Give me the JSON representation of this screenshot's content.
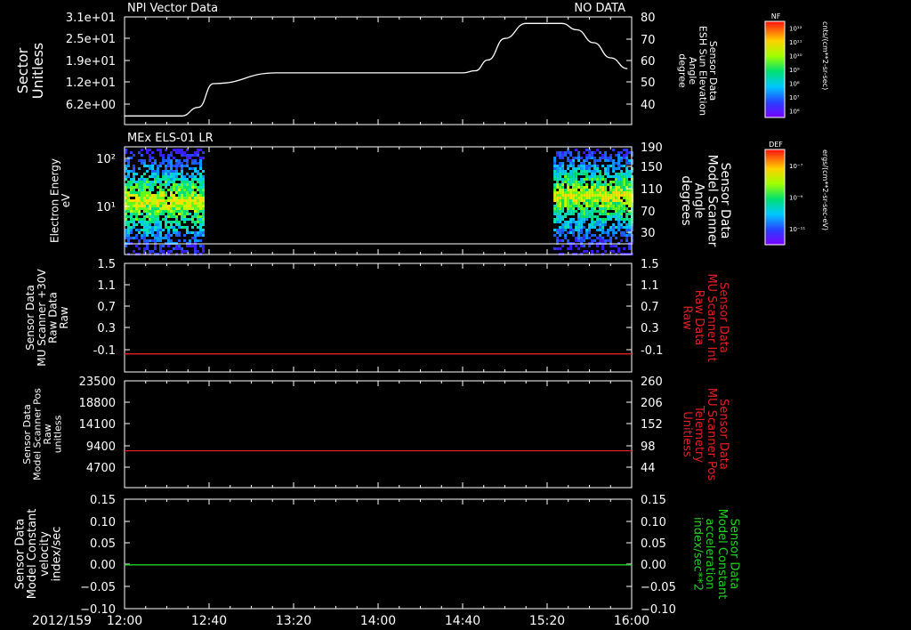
{
  "colors": {
    "background": "#000000",
    "axis": "#ffffff",
    "red_series": "#e02020",
    "green_series": "#20d020",
    "white_series": "#ffffff"
  },
  "time_axis": {
    "date_label": "2012/159",
    "ticks": [
      "12:00",
      "12:40",
      "13:20",
      "14:00",
      "14:40",
      "15:20",
      "16:00"
    ],
    "range_minutes": [
      0,
      240
    ]
  },
  "colorbars": [
    {
      "tag": "NF",
      "unit": "cnts/(cm**2-sr-sec)",
      "ticks": [
        "10¹²",
        "10¹¹",
        "10¹⁰",
        "10⁹",
        "10⁸",
        "10⁷",
        "10⁶"
      ]
    },
    {
      "tag": "DEF",
      "unit": "ergs/(cm**2-sr-sec-eV)",
      "ticks": [
        "10⁻⁷",
        "10⁻⁹",
        "10⁻¹¹"
      ]
    }
  ],
  "chart_data": [
    {
      "type": "line",
      "title": "NPI Vector Data",
      "status": "NO DATA",
      "left_axis": {
        "label_lines": [
          "Sector",
          "Unitless"
        ],
        "ticks": [
          "3.1e+01",
          "2.5e+01",
          "1.9e+01",
          "1.2e+01",
          "6.2e+00"
        ]
      },
      "right_axis": {
        "label_lines": [
          "Sensor Data",
          "ESH Sun Elevation",
          "Angle",
          "degree"
        ],
        "ticks": [
          "80",
          "70",
          "60",
          "50",
          "40"
        ],
        "ylim": [
          30,
          80
        ]
      },
      "series": [
        {
          "color": "white",
          "axis": "right",
          "x_minutes": [
            0,
            27,
            35,
            42,
            72,
            120,
            160,
            166,
            172,
            180,
            190,
            207,
            214,
            222,
            230,
            238
          ],
          "y": [
            34,
            34,
            38,
            49,
            54,
            54,
            54,
            55,
            60,
            70,
            77,
            77,
            74,
            68,
            61,
            56
          ]
        }
      ]
    },
    {
      "type": "heatmap",
      "title": "MEx ELS-01 LR",
      "left_axis": {
        "label_lines": [
          "Electron Energy",
          "eV"
        ],
        "ticks": [
          "10²",
          "10¹"
        ],
        "scale": "log"
      },
      "right_axis": {
        "label_lines": [
          "Sensor Data",
          "Model Scanner",
          "Angle",
          "degrees"
        ],
        "ticks": [
          "190",
          "150",
          "110",
          "70",
          "30"
        ]
      },
      "data_intervals_minutes": [
        [
          0,
          37
        ],
        [
          203,
          240
        ]
      ]
    },
    {
      "type": "line",
      "left_axis": {
        "label_lines": [
          "Sensor Data",
          "MU Scanner +30V",
          "Raw Data",
          "Raw"
        ],
        "ticks": [
          "1.5",
          "1.1",
          "0.7",
          "0.3",
          "-0.1"
        ],
        "ylim": [
          -0.3,
          1.5
        ]
      },
      "right_axis": {
        "label_lines": [
          "Sensor Data",
          "MU Scanner Int",
          "Raw Data",
          "Raw"
        ],
        "ticks": [
          "1.5",
          "1.1",
          "0.7",
          "0.3",
          "-0.1"
        ]
      },
      "series": [
        {
          "color": "red",
          "axis": "left",
          "x_minutes": [
            0,
            240
          ],
          "y": [
            0.0,
            0.0
          ]
        }
      ]
    },
    {
      "type": "line",
      "left_axis": {
        "label_lines": [
          "Sensor Data",
          "Model Scanner Pos",
          "Raw",
          "unitless"
        ],
        "ticks": [
          "23500",
          "18800",
          "14100",
          "9400",
          "4700"
        ],
        "ylim": [
          0,
          23500
        ]
      },
      "right_axis": {
        "label_lines": [
          "Sensor Data",
          "MU Scanner Pos",
          "Telemetry",
          "Unitless"
        ],
        "ticks": [
          "260",
          "206",
          "152",
          "98",
          "44"
        ]
      },
      "series": [
        {
          "color": "red",
          "axis": "left",
          "x_minutes": [
            0,
            240
          ],
          "y": [
            8100,
            8100
          ]
        }
      ]
    },
    {
      "type": "line",
      "left_axis": {
        "label_lines": [
          "Sensor Data",
          "Model Constant",
          "velocity",
          "index/sec"
        ],
        "ticks": [
          "0.15",
          "0.10",
          "0.05",
          "0.00",
          "−0.05",
          "−0.10"
        ],
        "ylim": [
          -0.1,
          0.15
        ]
      },
      "right_axis": {
        "label_lines": [
          "Sensor Data",
          "Model Constant",
          "acceleration",
          "index/sec**2"
        ],
        "ticks": [
          "0.15",
          "0.10",
          "0.05",
          "0.00",
          "−0.05",
          "−0.10"
        ]
      },
      "series": [
        {
          "color": "green",
          "axis": "left",
          "x_minutes": [
            0,
            240
          ],
          "y": [
            0.0,
            0.0
          ]
        }
      ]
    }
  ]
}
